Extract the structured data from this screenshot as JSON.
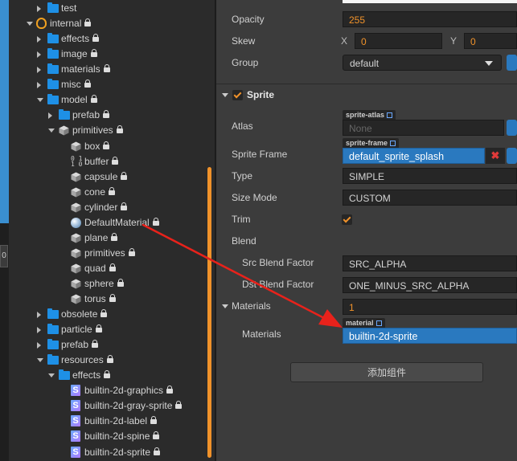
{
  "tree": {
    "items": [
      {
        "label": "test",
        "depth": 1,
        "expand": "right",
        "icon": "folder",
        "lock": false
      },
      {
        "label": "internal",
        "depth": 0,
        "expand": "down",
        "icon": "db",
        "lock": true
      },
      {
        "label": "effects",
        "depth": 1,
        "expand": "right",
        "icon": "folder",
        "lock": true
      },
      {
        "label": "image",
        "depth": 1,
        "expand": "right",
        "icon": "folder",
        "lock": true
      },
      {
        "label": "materials",
        "depth": 1,
        "expand": "right",
        "icon": "folder",
        "lock": true
      },
      {
        "label": "misc",
        "depth": 1,
        "expand": "right",
        "icon": "folder",
        "lock": true
      },
      {
        "label": "model",
        "depth": 1,
        "expand": "down",
        "icon": "folder",
        "lock": true
      },
      {
        "label": "prefab",
        "depth": 2,
        "expand": "right",
        "icon": "folder",
        "lock": true
      },
      {
        "label": "primitives",
        "depth": 2,
        "expand": "down",
        "icon": "cube",
        "lock": true
      },
      {
        "label": "box",
        "depth": 3,
        "expand": "none",
        "icon": "cube",
        "lock": true
      },
      {
        "label": "buffer",
        "depth": 3,
        "expand": "none",
        "icon": "binary",
        "lock": true
      },
      {
        "label": "capsule",
        "depth": 3,
        "expand": "none",
        "icon": "cube",
        "lock": true
      },
      {
        "label": "cone",
        "depth": 3,
        "expand": "none",
        "icon": "cube",
        "lock": true
      },
      {
        "label": "cylinder",
        "depth": 3,
        "expand": "none",
        "icon": "cube",
        "lock": true
      },
      {
        "label": "DefaultMaterial",
        "depth": 3,
        "expand": "none",
        "icon": "ball",
        "lock": true
      },
      {
        "label": "plane",
        "depth": 3,
        "expand": "none",
        "icon": "cube",
        "lock": true
      },
      {
        "label": "primitives",
        "depth": 3,
        "expand": "none",
        "icon": "cube",
        "lock": true
      },
      {
        "label": "quad",
        "depth": 3,
        "expand": "none",
        "icon": "cube",
        "lock": true
      },
      {
        "label": "sphere",
        "depth": 3,
        "expand": "none",
        "icon": "cube",
        "lock": true
      },
      {
        "label": "torus",
        "depth": 3,
        "expand": "none",
        "icon": "cube",
        "lock": true
      },
      {
        "label": "obsolete",
        "depth": 1,
        "expand": "right",
        "icon": "folder",
        "lock": true
      },
      {
        "label": "particle",
        "depth": 1,
        "expand": "right",
        "icon": "folder",
        "lock": true
      },
      {
        "label": "prefab",
        "depth": 1,
        "expand": "right",
        "icon": "folder",
        "lock": true
      },
      {
        "label": "resources",
        "depth": 1,
        "expand": "down",
        "icon": "folder",
        "lock": true
      },
      {
        "label": "effects",
        "depth": 2,
        "expand": "down",
        "icon": "folder",
        "lock": true
      },
      {
        "label": "builtin-2d-graphics",
        "depth": 3,
        "expand": "none",
        "icon": "shader",
        "lock": true
      },
      {
        "label": "builtin-2d-gray-sprite",
        "depth": 3,
        "expand": "none",
        "icon": "shader",
        "lock": true
      },
      {
        "label": "builtin-2d-label",
        "depth": 3,
        "expand": "none",
        "icon": "shader",
        "lock": true
      },
      {
        "label": "builtin-2d-spine",
        "depth": 3,
        "expand": "none",
        "icon": "shader",
        "lock": true
      },
      {
        "label": "builtin-2d-sprite",
        "depth": 3,
        "expand": "none",
        "icon": "shader",
        "lock": true
      }
    ],
    "shader_glyph": "S",
    "buffer_glyph": "0 1\n1 0"
  },
  "left_tab": "0",
  "inspector": {
    "node": {
      "opacity_label": "Opacity",
      "opacity_value": "255",
      "skew_label": "Skew",
      "skew_x_axis": "X",
      "skew_x": "0",
      "skew_y_axis": "Y",
      "skew_y": "0",
      "group_label": "Group",
      "group_value": "default"
    },
    "sprite": {
      "title": "Sprite",
      "enabled": true,
      "atlas_label": "Atlas",
      "atlas_tag": "sprite-atlas",
      "atlas_value": "None",
      "frame_label": "Sprite Frame",
      "frame_tag": "sprite-frame",
      "frame_value": "default_sprite_splash",
      "delete_glyph": "✖",
      "type_label": "Type",
      "type_value": "SIMPLE",
      "sizemode_label": "Size Mode",
      "sizemode_value": "CUSTOM",
      "trim_label": "Trim",
      "trim_checked": true,
      "blend_label": "Blend",
      "src_label": "Src Blend Factor",
      "src_value": "SRC_ALPHA",
      "dst_label": "Dst Blend Factor",
      "dst_value": "ONE_MINUS_SRC_ALPHA",
      "materials_label": "Materials",
      "materials_count": "1",
      "material_item_label": "Materials",
      "material_tag": "material",
      "material_value": "builtin-2d-sprite"
    },
    "add_component_label": "添加组件"
  },
  "colors": {
    "accent": "#f0922a",
    "selection_blue": "#2a79bf",
    "annotation_arrow": "#e8221b"
  },
  "icons": {
    "folder": "folder-icon",
    "db": "database-icon",
    "cube": "mesh-cube-icon",
    "ball": "material-sphere-icon",
    "shader": "shader-effect-icon",
    "binary": "buffer-binary-icon",
    "lock": "lock-icon"
  }
}
